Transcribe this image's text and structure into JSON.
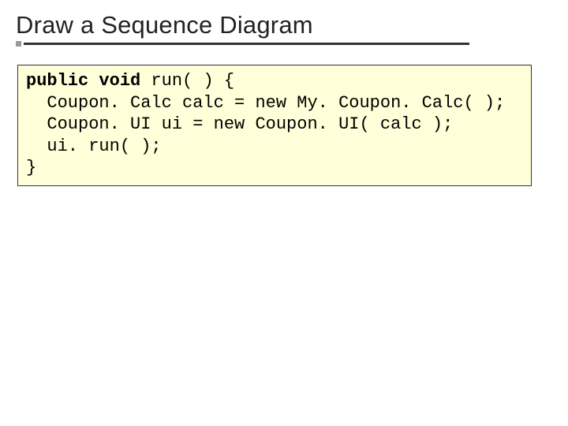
{
  "title": "Draw a Sequence Diagram",
  "code": {
    "l1_kw": "public void",
    "l1_rest": " run( ) {",
    "l2": "  Coupon. Calc calc = new My. Coupon. Calc( );",
    "l3": "  Coupon. UI ui = new Coupon. UI( calc );",
    "l4": "  ui. run( );",
    "l5": "}"
  }
}
